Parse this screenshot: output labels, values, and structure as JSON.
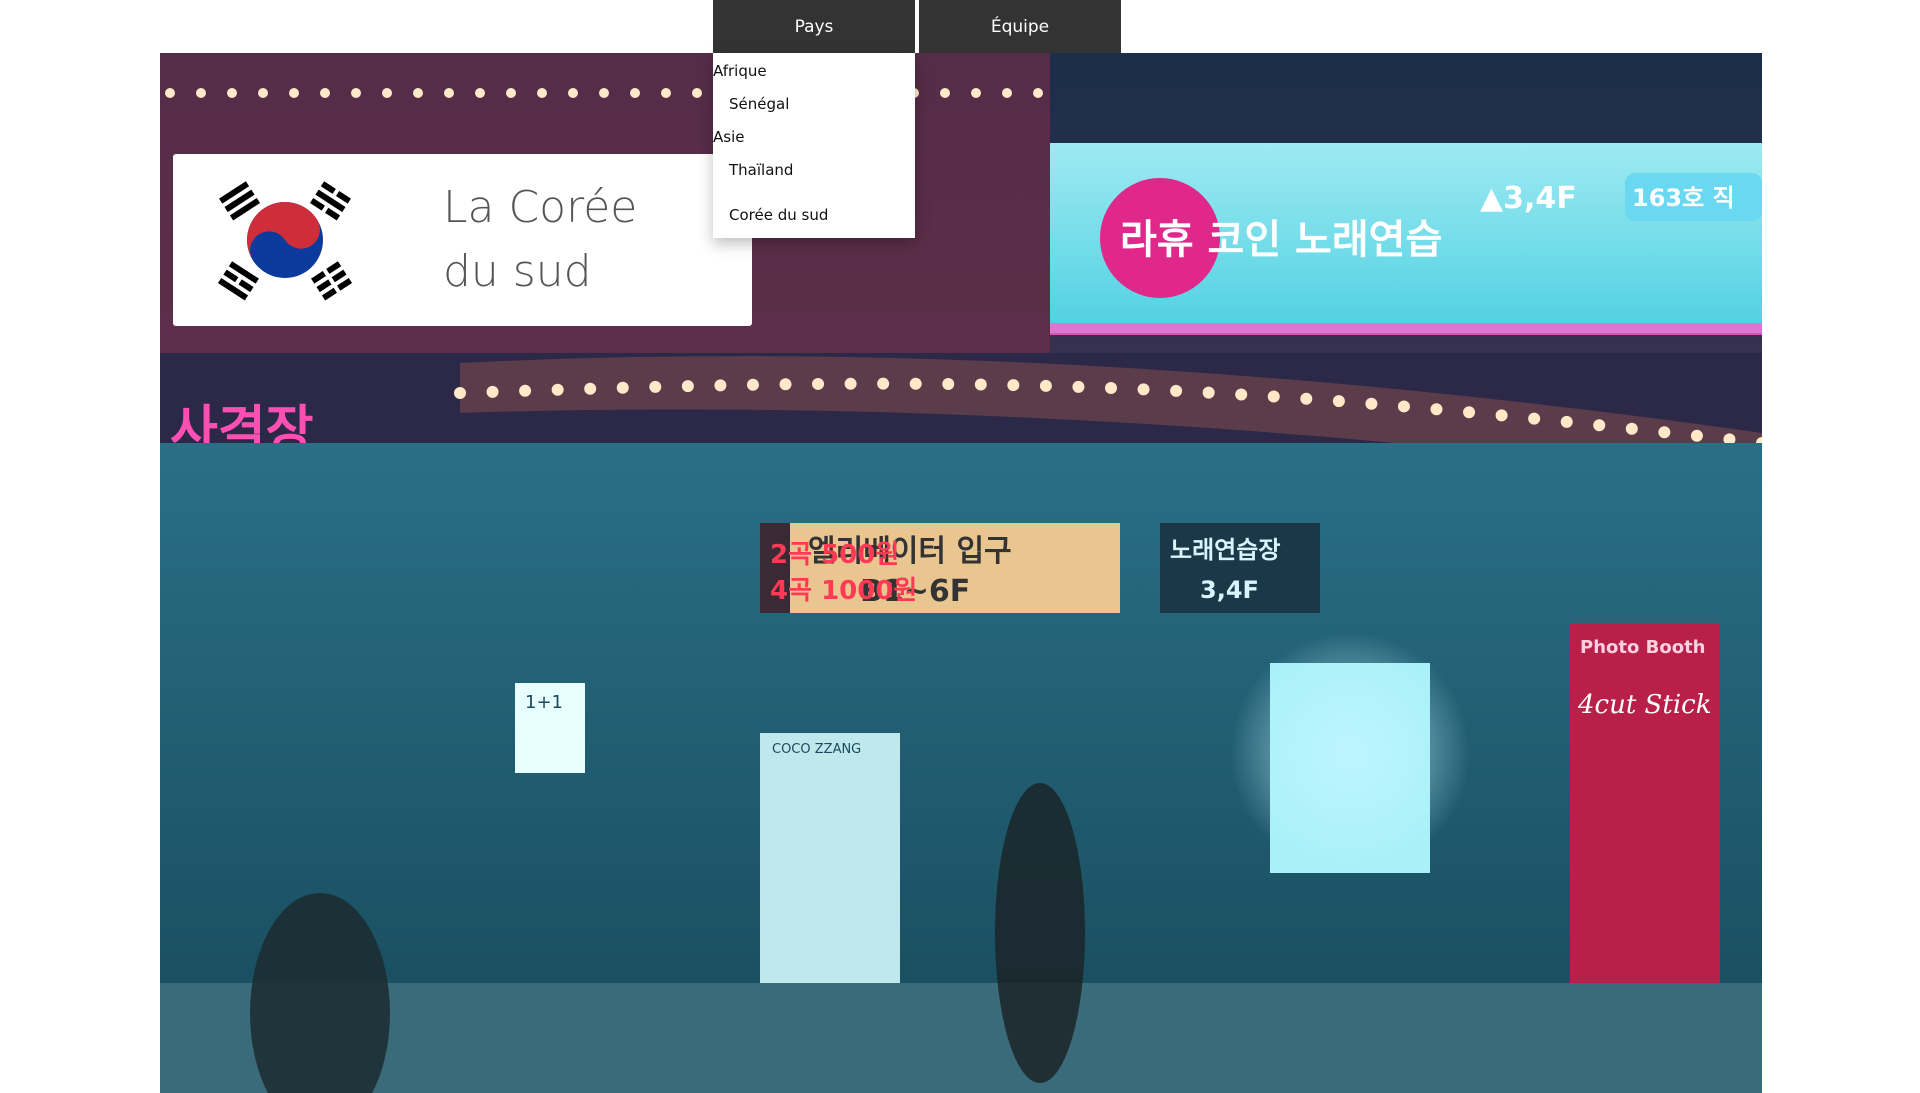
{
  "nav": {
    "tabs": [
      {
        "label": "Pays"
      },
      {
        "label": "Équipe"
      }
    ],
    "pays_menu": {
      "groups": [
        {
          "label": "Afrique",
          "items": [
            "Sénégal"
          ]
        },
        {
          "label": "Asie",
          "items": [
            "Thaïland"
          ]
        }
      ],
      "extra_item": "Corée du sud"
    }
  },
  "card": {
    "title": "La Corée du sud",
    "flag_icon": "south-korea-flag-icon"
  },
  "hero": {
    "signs": {
      "main_sign": "라휴 코인 노래연습",
      "floor_badge": "▲3,4F",
      "room_sign": "163호 직",
      "left_sign": "사격장",
      "elevator_sign": "엘리베이터 입구",
      "elevator_floors": "B1~6F",
      "price_1": "2곡 500원",
      "price_2": "4곡 1000원",
      "karaoke_sign": "노래연습장",
      "karaoke_floor": "3,4F",
      "photo_booth": "Photo Booth",
      "photo_script": "4cut Stick",
      "kiosk": "1+1",
      "machine_label": "COCO ZZANG"
    },
    "colors": {
      "neon_pink": "#e0288a",
      "neon_cyan": "#7fe8f2",
      "marquee_light": "#ffe9c8"
    }
  }
}
